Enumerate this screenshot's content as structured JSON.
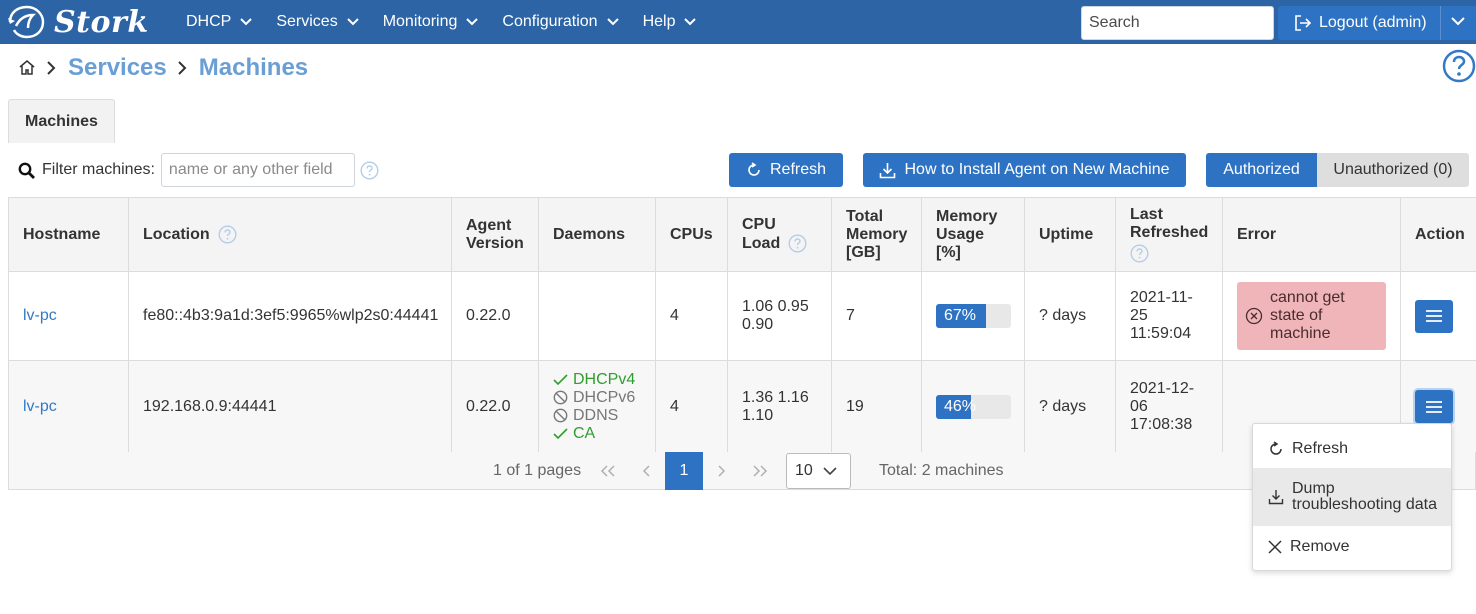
{
  "app": {
    "logo_text": "Stork",
    "brand_color": "#2c64a5",
    "accent_color": "#2e73c3"
  },
  "nav": {
    "menu": [
      {
        "label": "DHCP"
      },
      {
        "label": "Services"
      },
      {
        "label": "Monitoring"
      },
      {
        "label": "Configuration"
      },
      {
        "label": "Help"
      }
    ],
    "search_placeholder": "Search",
    "logout_label": "Logout (admin)"
  },
  "breadcrumb": {
    "items": [
      "Services",
      "Machines"
    ]
  },
  "tab": {
    "label": "Machines"
  },
  "toolbar": {
    "filter_label": "Filter machines:",
    "filter_placeholder": "name or any other field",
    "refresh_label": "Refresh",
    "install_label": "How to Install Agent on New Machine",
    "authorized_label": "Authorized",
    "unauthorized_label": "Unauthorized (0)"
  },
  "table": {
    "headers": {
      "hostname": "Hostname",
      "location": "Location",
      "agent_version_1": "Agent",
      "agent_version_2": "Version",
      "daemons": "Daemons",
      "cpus": "CPUs",
      "cpu_load_1": "CPU",
      "cpu_load_2": "Load",
      "total_memory_1": "Total",
      "total_memory_2": "Memory",
      "total_memory_3": "[GB]",
      "memory_usage_1": "Memory",
      "memory_usage_2": "Usage",
      "memory_usage_3": "[%]",
      "uptime": "Uptime",
      "last_refreshed_1": "Last",
      "last_refreshed_2": "Refreshed",
      "error": "Error",
      "action": "Action"
    },
    "rows": [
      {
        "hostname": "lv-pc",
        "location": "fe80::4b3:9a1d:3ef5:9965%wlp2s0:44441",
        "agent_version": "0.22.0",
        "daemons": [],
        "cpus": "4",
        "cpu_load_1": "1.06 0.95",
        "cpu_load_2": "0.90",
        "total_memory": "7",
        "memory_usage": 67,
        "memory_usage_label": "67%",
        "uptime": "? days",
        "last_refreshed_1": "2021-11-",
        "last_refreshed_2": "25",
        "last_refreshed_3": "11:59:04",
        "error_1": "cannot get",
        "error_2": "state of",
        "error_3": "machine"
      },
      {
        "hostname": "lv-pc",
        "location": "192.168.0.9:44441",
        "agent_version": "0.22.0",
        "daemons": [
          {
            "name": "DHCPv4",
            "active": true
          },
          {
            "name": "DHCPv6",
            "active": false
          },
          {
            "name": "DDNS",
            "active": false
          },
          {
            "name": "CA",
            "active": true
          }
        ],
        "cpus": "4",
        "cpu_load_1": "1.36 1.16",
        "cpu_load_2": "1.10",
        "total_memory": "19",
        "memory_usage": 46,
        "memory_usage_label": "46%",
        "uptime": "? days",
        "last_refreshed_1": "2021-12-",
        "last_refreshed_2": "06",
        "last_refreshed_3": "17:08:38",
        "error_1": "",
        "error_2": "",
        "error_3": ""
      }
    ]
  },
  "paginator": {
    "page_info": "1 of 1 pages",
    "current_page": "1",
    "rows_per_page": "10",
    "total": "Total: 2 machines"
  },
  "action_menu": {
    "refresh": "Refresh",
    "dump_1": "Dump",
    "dump_2": "troubleshooting data",
    "remove": "Remove"
  }
}
